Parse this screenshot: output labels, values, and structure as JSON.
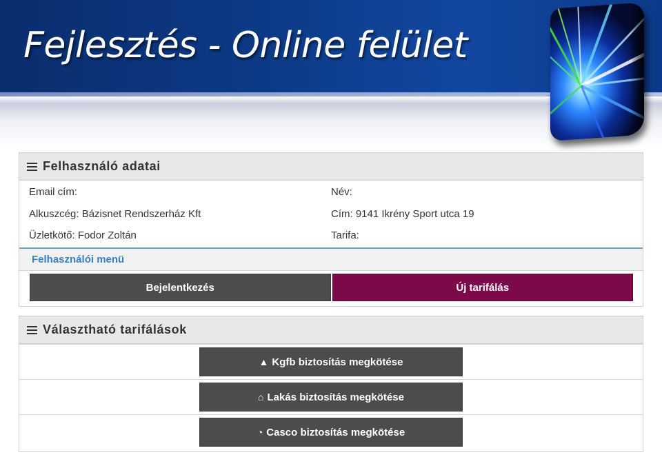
{
  "slide": {
    "title": "Fejlesztés - Online felület"
  },
  "user_panel": {
    "title": "Felhasználó adatai",
    "email_label": "Email cím:",
    "name_label": "Név:",
    "broker_text": "Alkuszcég: Bázisnet Rendszerház Kft",
    "address_text": "Cím: 9141 Ikrény Sport utca 19",
    "agent_text": "Üzletkötő: Fodor Zoltán",
    "tariff_label": "Tarifa:",
    "menu_title": "Felhasználói menü",
    "login_button": "Bejelentkezés",
    "new_tariff_button": "Új tarifálás"
  },
  "tariff_panel": {
    "title": "Választható tarifálások",
    "options": [
      {
        "label": "Kgfb biztosítás megkötése",
        "icon": "road-icon"
      },
      {
        "label": "Lakás biztosítás megkötése",
        "icon": "home-icon"
      },
      {
        "label": "Casco biztosítás megkötése",
        "icon": "dashboard-icon"
      }
    ]
  },
  "colors": {
    "header_blue": "#0d3a86",
    "button_dark": "#4c4c4c",
    "button_accent": "#7c0a4b",
    "menu_link": "#3a7fc1"
  }
}
